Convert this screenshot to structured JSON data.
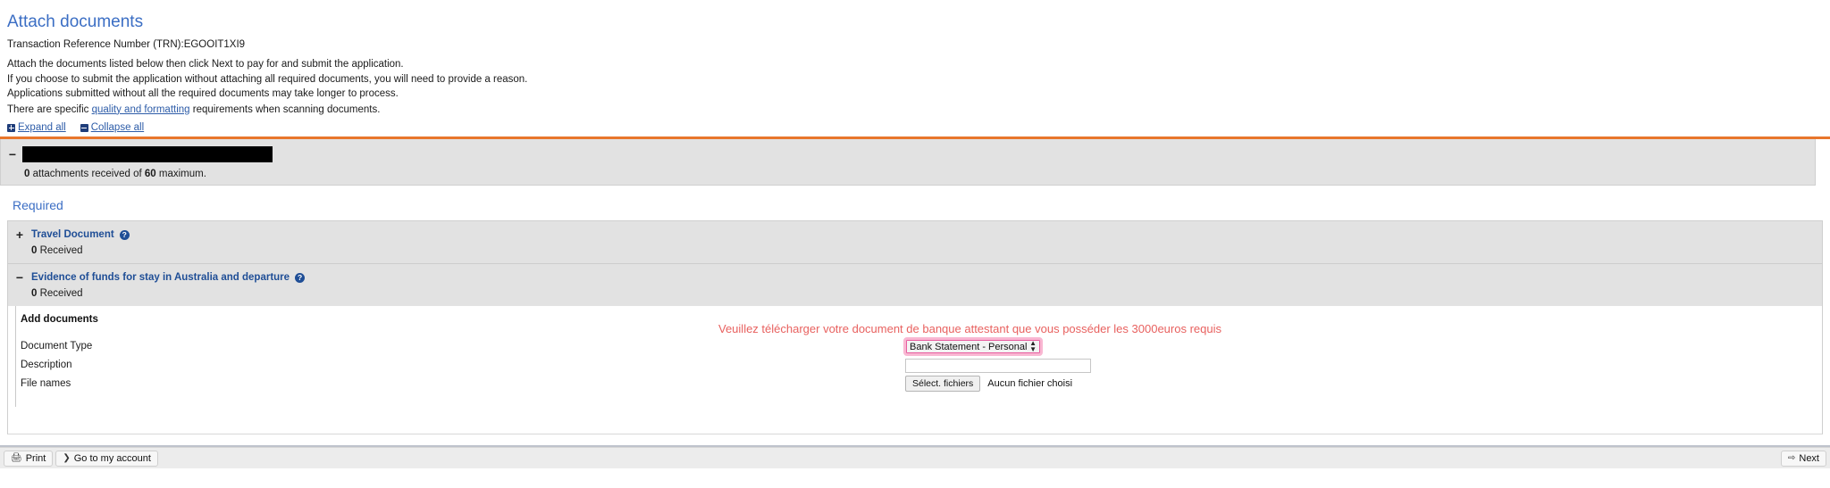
{
  "header": {
    "title": "Attach documents",
    "trn_label": "Transaction Reference Number (TRN):EGOOIT1XI9",
    "lines": [
      "Attach the documents listed below then click Next to pay for and submit the application.",
      "If you choose to submit the application without attaching all required documents, you will need to provide a reason.",
      "Applications submitted without all the required documents may take longer to process."
    ],
    "quality_line_prefix": "There are specific ",
    "quality_link": "quality and formatting",
    "quality_line_suffix": " requirements when scanning documents."
  },
  "toggles": {
    "expand_all": "Expand all",
    "collapse_all": "Collapse all",
    "expand_icon": "plus-square-icon",
    "collapse_icon": "minus-square-icon"
  },
  "attachments_panel": {
    "collapse_glyph": "−",
    "redacted": "",
    "count_prefix": "0",
    "count_mid": " attachments received of ",
    "count_max": "60",
    "count_suffix": " maximum."
  },
  "required": {
    "heading": "Required",
    "documents": [
      {
        "toggle_glyph": "+",
        "title": "Travel Document",
        "help_icon": "question-mark-icon",
        "help_glyph": "?",
        "received_count": "0",
        "received_label": " Received"
      },
      {
        "toggle_glyph": "−",
        "title": "Evidence of funds for stay in Australia and departure",
        "help_icon": "question-mark-icon",
        "help_glyph": "?",
        "received_count": "0",
        "received_label": " Received"
      }
    ]
  },
  "add_documents": {
    "title": "Add documents",
    "annotation": "Veuillez télécharger votre document de banque attestant que vous posséder les 3000euros requis",
    "annotation_color": "#e8615f",
    "fields": {
      "document_type_label": "Document Type",
      "document_type_value": "Bank Statement - Personal",
      "document_type_options": [
        "Bank Statement - Personal"
      ],
      "description_label": "Description",
      "description_value": "",
      "description_placeholder": "",
      "file_names_label": "File names",
      "file_button_label": "Sélect. fichiers",
      "file_status": "Aucun fichier choisi"
    },
    "focus_color": "#e85da0"
  },
  "bottom_bar": {
    "print_label": "Print",
    "print_icon": "printer-icon",
    "account_label": "Go to my account",
    "account_icon": "chevron-right-icon",
    "next_label": "Next",
    "next_icon": "arrow-right-icon"
  },
  "colors": {
    "accent_orange": "#e8762c",
    "title_blue": "#3b6ec4",
    "link_blue": "#2d5ca8",
    "panel_grey": "#e2e2e2"
  }
}
